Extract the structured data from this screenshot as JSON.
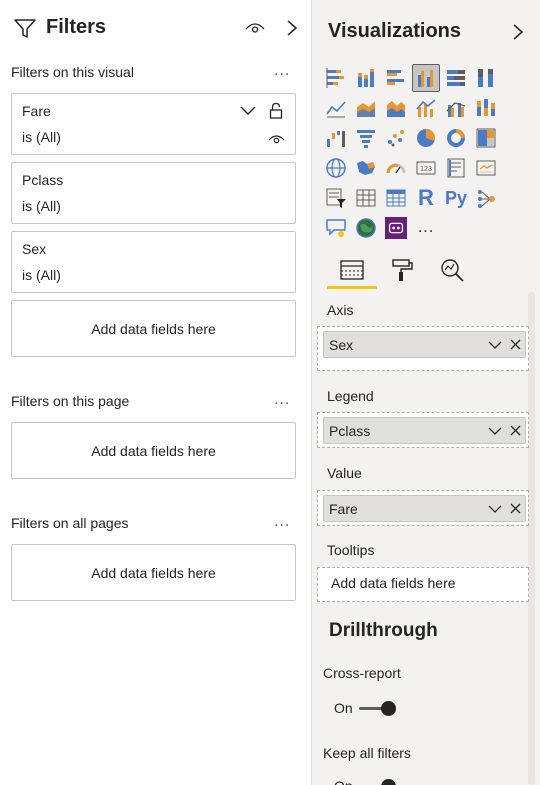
{
  "filters": {
    "title": "Filters",
    "sections": {
      "visual": {
        "label": "Filters on this visual",
        "more": "...",
        "cards": [
          {
            "name": "Fare",
            "value": "is (All)"
          },
          {
            "name": "Pclass",
            "value": "is (All)"
          },
          {
            "name": "Sex",
            "value": "is (All)"
          }
        ],
        "drop": "Add data fields here"
      },
      "page": {
        "label": "Filters on this page",
        "more": "...",
        "drop": "Add data fields here"
      },
      "all": {
        "label": "Filters on all pages",
        "more": "...",
        "drop": "Add data fields here"
      }
    },
    "icons": {
      "funnel": "funnel-icon",
      "eye": "eye-icon",
      "collapse": "chevron-right-icon",
      "lock": "lock-icon",
      "dropdown": "chevron-down-icon"
    }
  },
  "visualizations": {
    "title": "Visualizations",
    "more": "...",
    "glyphs": {
      "r": "R",
      "py": "Py"
    },
    "selected_visual": "clustered-column-chart",
    "tabs": [
      "fields-tab",
      "format-tab",
      "analytics-tab"
    ],
    "active_tab": "fields-tab",
    "wells": [
      {
        "label": "Axis",
        "field": "Sex"
      },
      {
        "label": "Legend",
        "field": "Pclass"
      },
      {
        "label": "Value",
        "field": "Fare"
      },
      {
        "label": "Tooltips",
        "placeholder": "Add data fields here"
      }
    ],
    "drillthrough": {
      "title": "Drillthrough",
      "cross_report": {
        "label": "Cross-report",
        "state": "On"
      },
      "keep_all_filters": {
        "label": "Keep all filters",
        "state": "On"
      }
    }
  },
  "colors": {
    "accent_yellow": "#f2c811",
    "chart_blue": "#4a7cc4",
    "chart_orange": "#e8962e",
    "pane_bg": "#f3f2f1",
    "pill_bg": "#e1dfdd",
    "purple": "#6b1f7c"
  }
}
